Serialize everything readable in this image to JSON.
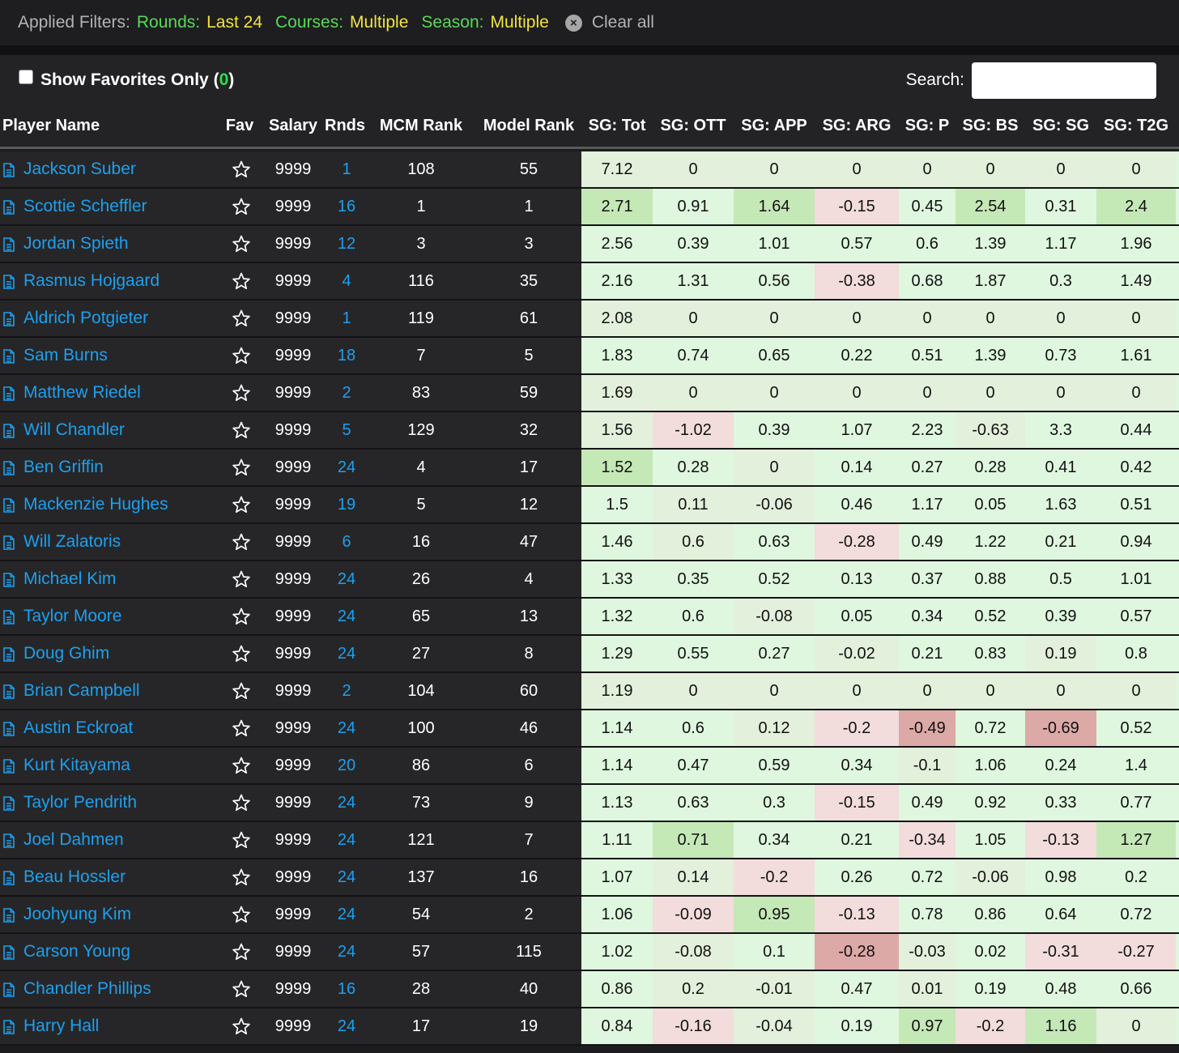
{
  "filters": {
    "label": "Applied Filters:",
    "items": [
      {
        "key": "Rounds:",
        "value": "Last 24"
      },
      {
        "key": "Courses:",
        "value": "Multiple"
      },
      {
        "key": "Season:",
        "value": "Multiple"
      }
    ],
    "clear_label": "Clear all"
  },
  "controls": {
    "favorites_label": "Show Favorites Only",
    "favorites_open": "(",
    "favorites_count": "0",
    "favorites_close": ")",
    "search_label": "Search:",
    "search_value": ""
  },
  "colors": {
    "link": "#1da0ef",
    "filter_key": "#59d957",
    "filter_value": "#f0e441",
    "fav_count": "#27e34a",
    "cell_light_green": "#dff7df",
    "cell_green": "#c5e8b7",
    "cell_pink": "#f3dcdc",
    "cell_red": "#dca9a6"
  },
  "columns": [
    "Player Name",
    "Fav",
    "Salary",
    "Rnds",
    "MCM Rank",
    "Model Rank",
    "SG: Tot",
    "SG: OTT",
    "SG: APP",
    "SG: ARG",
    "SG: P",
    "SG: BS",
    "SG: SG",
    "SG: T2G"
  ],
  "rows": [
    {
      "name": "Jackson Suber",
      "salary": "9999",
      "rnds": "1",
      "mcm": "108",
      "model": "55",
      "sg": [
        "7.12",
        "0",
        "0",
        "0",
        "0",
        "0",
        "0",
        "0"
      ]
    },
    {
      "name": "Scottie Scheffler",
      "salary": "9999",
      "rnds": "16",
      "mcm": "1",
      "model": "1",
      "sg": [
        "2.71",
        "0.91",
        "1.64",
        "-0.15",
        "0.45",
        "2.54",
        "0.31",
        "2.4"
      ]
    },
    {
      "name": "Jordan Spieth",
      "salary": "9999",
      "rnds": "12",
      "mcm": "3",
      "model": "3",
      "sg": [
        "2.56",
        "0.39",
        "1.01",
        "0.57",
        "0.6",
        "1.39",
        "1.17",
        "1.96"
      ]
    },
    {
      "name": "Rasmus Hojgaard",
      "salary": "9999",
      "rnds": "4",
      "mcm": "116",
      "model": "35",
      "sg": [
        "2.16",
        "1.31",
        "0.56",
        "-0.38",
        "0.68",
        "1.87",
        "0.3",
        "1.49"
      ]
    },
    {
      "name": "Aldrich Potgieter",
      "salary": "9999",
      "rnds": "1",
      "mcm": "119",
      "model": "61",
      "sg": [
        "2.08",
        "0",
        "0",
        "0",
        "0",
        "0",
        "0",
        "0"
      ]
    },
    {
      "name": "Sam Burns",
      "salary": "9999",
      "rnds": "18",
      "mcm": "7",
      "model": "5",
      "sg": [
        "1.83",
        "0.74",
        "0.65",
        "0.22",
        "0.51",
        "1.39",
        "0.73",
        "1.61"
      ]
    },
    {
      "name": "Matthew Riedel",
      "salary": "9999",
      "rnds": "2",
      "mcm": "83",
      "model": "59",
      "sg": [
        "1.69",
        "0",
        "0",
        "0",
        "0",
        "0",
        "0",
        "0"
      ]
    },
    {
      "name": "Will Chandler",
      "salary": "9999",
      "rnds": "5",
      "mcm": "129",
      "model": "32",
      "sg": [
        "1.56",
        "-1.02",
        "0.39",
        "1.07",
        "2.23",
        "-0.63",
        "3.3",
        "0.44"
      ]
    },
    {
      "name": "Ben Griffin",
      "salary": "9999",
      "rnds": "24",
      "mcm": "4",
      "model": "17",
      "sg": [
        "1.52",
        "0.28",
        "0",
        "0.14",
        "0.27",
        "0.28",
        "0.41",
        "0.42"
      ]
    },
    {
      "name": "Mackenzie Hughes",
      "salary": "9999",
      "rnds": "19",
      "mcm": "5",
      "model": "12",
      "sg": [
        "1.5",
        "0.11",
        "-0.06",
        "0.46",
        "1.17",
        "0.05",
        "1.63",
        "0.51"
      ]
    },
    {
      "name": "Will Zalatoris",
      "salary": "9999",
      "rnds": "6",
      "mcm": "16",
      "model": "47",
      "sg": [
        "1.46",
        "0.6",
        "0.63",
        "-0.28",
        "0.49",
        "1.22",
        "0.21",
        "0.94"
      ]
    },
    {
      "name": "Michael Kim",
      "salary": "9999",
      "rnds": "24",
      "mcm": "26",
      "model": "4",
      "sg": [
        "1.33",
        "0.35",
        "0.52",
        "0.13",
        "0.37",
        "0.88",
        "0.5",
        "1.01"
      ]
    },
    {
      "name": "Taylor Moore",
      "salary": "9999",
      "rnds": "24",
      "mcm": "65",
      "model": "13",
      "sg": [
        "1.32",
        "0.6",
        "-0.08",
        "0.05",
        "0.34",
        "0.52",
        "0.39",
        "0.57"
      ]
    },
    {
      "name": "Doug Ghim",
      "salary": "9999",
      "rnds": "24",
      "mcm": "27",
      "model": "8",
      "sg": [
        "1.29",
        "0.55",
        "0.27",
        "-0.02",
        "0.21",
        "0.83",
        "0.19",
        "0.8"
      ]
    },
    {
      "name": "Brian Campbell",
      "salary": "9999",
      "rnds": "2",
      "mcm": "104",
      "model": "60",
      "sg": [
        "1.19",
        "0",
        "0",
        "0",
        "0",
        "0",
        "0",
        "0"
      ]
    },
    {
      "name": "Austin Eckroat",
      "salary": "9999",
      "rnds": "24",
      "mcm": "100",
      "model": "46",
      "sg": [
        "1.14",
        "0.6",
        "0.12",
        "-0.2",
        "-0.49",
        "0.72",
        "-0.69",
        "0.52"
      ]
    },
    {
      "name": "Kurt Kitayama",
      "salary": "9999",
      "rnds": "20",
      "mcm": "86",
      "model": "6",
      "sg": [
        "1.14",
        "0.47",
        "0.59",
        "0.34",
        "-0.1",
        "1.06",
        "0.24",
        "1.4"
      ]
    },
    {
      "name": "Taylor Pendrith",
      "salary": "9999",
      "rnds": "24",
      "mcm": "73",
      "model": "9",
      "sg": [
        "1.13",
        "0.63",
        "0.3",
        "-0.15",
        "0.49",
        "0.92",
        "0.33",
        "0.77"
      ]
    },
    {
      "name": "Joel Dahmen",
      "salary": "9999",
      "rnds": "24",
      "mcm": "121",
      "model": "7",
      "sg": [
        "1.11",
        "0.71",
        "0.34",
        "0.21",
        "-0.34",
        "1.05",
        "-0.13",
        "1.27"
      ]
    },
    {
      "name": "Beau Hossler",
      "salary": "9999",
      "rnds": "24",
      "mcm": "137",
      "model": "16",
      "sg": [
        "1.07",
        "0.14",
        "-0.2",
        "0.26",
        "0.72",
        "-0.06",
        "0.98",
        "0.2"
      ]
    },
    {
      "name": "Joohyung Kim",
      "salary": "9999",
      "rnds": "24",
      "mcm": "54",
      "model": "2",
      "sg": [
        "1.06",
        "-0.09",
        "0.95",
        "-0.13",
        "0.78",
        "0.86",
        "0.64",
        "0.72"
      ]
    },
    {
      "name": "Carson Young",
      "salary": "9999",
      "rnds": "24",
      "mcm": "57",
      "model": "115",
      "sg": [
        "1.02",
        "-0.08",
        "0.1",
        "-0.28",
        "-0.03",
        "0.02",
        "-0.31",
        "-0.27"
      ]
    },
    {
      "name": "Chandler Phillips",
      "salary": "9999",
      "rnds": "16",
      "mcm": "28",
      "model": "40",
      "sg": [
        "0.86",
        "0.2",
        "-0.01",
        "0.47",
        "0.01",
        "0.19",
        "0.48",
        "0.66"
      ]
    },
    {
      "name": "Harry Hall",
      "salary": "9999",
      "rnds": "24",
      "mcm": "17",
      "model": "19",
      "sg": [
        "0.84",
        "-0.16",
        "-0.04",
        "0.19",
        "0.97",
        "-0.2",
        "1.16",
        "0"
      ]
    }
  ]
}
